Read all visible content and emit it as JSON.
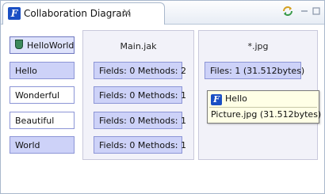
{
  "view": {
    "tab_title": "Collaboration Diagram",
    "tab_icon": "feature-f-icon",
    "close_icon": "close-icon",
    "sync_icon": "sync-icon",
    "minimize_icon": "minimize-icon",
    "maximize_icon": "maximize-icon"
  },
  "roles": {
    "header": "HelloWorld",
    "items": [
      "Hello",
      "Wonderful",
      "Beautiful",
      "World"
    ]
  },
  "classes": [
    {
      "title": "Main.jak",
      "cells": [
        "Fields: 0 Methods: 2",
        "Fields: 0 Methods: 1",
        "Fields: 0 Methods: 1",
        "Fields: 0 Methods: 1"
      ]
    },
    {
      "title": "*.jpg",
      "cells": [
        "Files: 1 (31.512bytes)"
      ]
    }
  ],
  "tooltip": {
    "icon": "feature-f-icon",
    "title": "Hello",
    "body": "Picture.jpg (31.512bytes)"
  },
  "colors": {
    "highlight": "#cdd2f8",
    "panel": "#f2f2f9",
    "tooltip": "#ffffe6",
    "accent": "#1a4fc4"
  }
}
